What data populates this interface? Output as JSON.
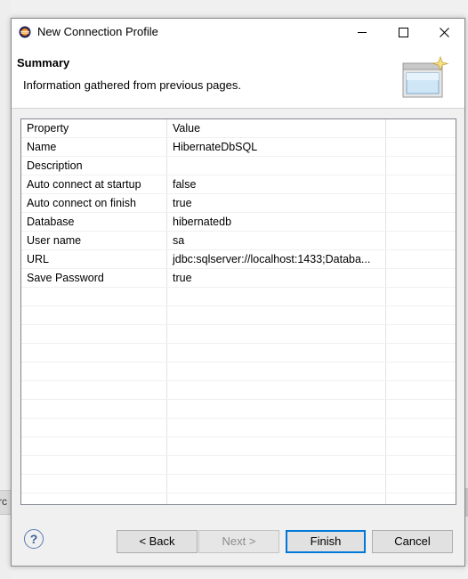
{
  "window": {
    "title": "New Connection Profile"
  },
  "banner": {
    "title": "Summary",
    "description": "Information gathered from previous pages."
  },
  "properties": {
    "header": {
      "property": "Property",
      "value": "Value"
    },
    "rows": [
      {
        "property": "Name",
        "value": "HibernateDbSQL"
      },
      {
        "property": "Description",
        "value": ""
      },
      {
        "property": "Auto connect at startup",
        "value": "false"
      },
      {
        "property": "Auto connect on finish",
        "value": "true"
      },
      {
        "property": "Database",
        "value": "hibernatedb"
      },
      {
        "property": "User name",
        "value": "sa"
      },
      {
        "property": "URL",
        "value": "jdbc:sqlserver://localhost:1433;Databa..."
      },
      {
        "property": "Save Password",
        "value": "true"
      }
    ]
  },
  "buttons": {
    "help": "?",
    "back": "< Back",
    "next": "Next >",
    "finish": "Finish",
    "cancel": "Cancel"
  },
  "background": {
    "partial_text": "rc"
  },
  "icons": {
    "app": "eclipse-icon",
    "banner": "database-wizard-icon"
  },
  "colors": {
    "accent": "#0078d7"
  }
}
